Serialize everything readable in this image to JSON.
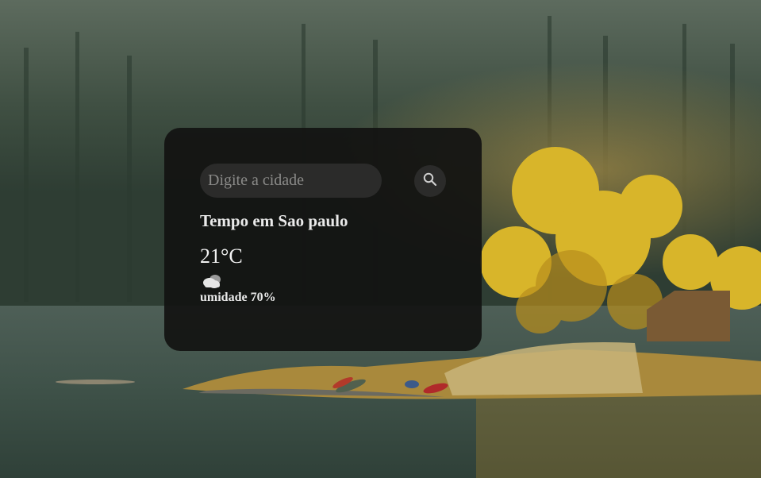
{
  "search": {
    "placeholder": "Digite a cidade",
    "value": "",
    "button_icon": "search-icon"
  },
  "weather": {
    "title": "Tempo em Sao paulo",
    "temperature": "21°C",
    "condition_icon": "cloud-icon",
    "humidity": "umidade 70%"
  },
  "colors": {
    "card_background": "#121211",
    "input_background": "#2b2b2a",
    "text": "#eaeaea"
  }
}
